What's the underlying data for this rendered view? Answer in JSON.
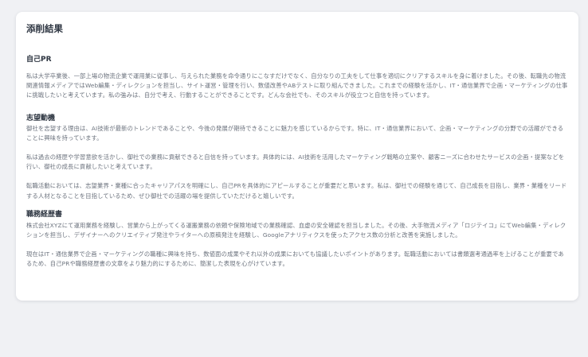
{
  "card": {
    "title": "添削結果"
  },
  "sections": {
    "pr": {
      "heading": "自己PR",
      "paragraphs": [
        "私は大学卒業後、一部上場の物流企業で運用業に従事し、与えられた業務を命令通りにこなすだけでなく、自分なりの工夫をして仕事を適切にクリアするスキルを身に着けました。その後、転職先の物流関連情報メディアではWeb編集・ディレクションを担当し、サイト運営・管理を行い、数値改善やABテストに取り組んできました。これまでの経験を活かし、IT・通信業界で企画・マーケティングの仕事に挑戦したいと考えています。私の強みは、自分で考え、行動することができることです。どんな会社でも、そのスキルが役立つと自信を持っています。"
      ]
    },
    "motive": {
      "heading": "志望動機",
      "paragraphs": [
        "御社を志望する理由は、AI技術が最新のトレンドであることや、今後の発展が期待できることに魅力を感じているからです。特に、IT・通信業界において、企画・マーケティングの分野での活躍ができることに興味を持っています。",
        "私は過去の経歴や学習意欲を活かし、御社での業務に貢献できると自信を持っています。具体的には、AI技術を活用したマーケティング戦略の立案や、顧客ニーズに合わせたサービスの企画・提案などを行い、御社の成長に貢献したいと考えています。",
        "転職活動においては、志望業界・業種に合ったキャリアパスを明確にし、自己PRを具体的にアピールすることが重要だと思います。私は、御社での経験を通じて、自己成長を目指し、業界・業種をリードする人材となることを目指しているため、ぜひ御社での活躍の場を提供していただけると嬉しいです。"
      ]
    },
    "career": {
      "heading": "職務経歴書",
      "paragraphs": [
        "株式会社XYZにて運用業務を経験し、営業から上がってくる運搬業務の依頼や保険地域での業務確認、血虚の安全確認を担当しました。その後、大手物流メディア「ロジテイコ」にてWeb編集・ディレクションを担当し、デザイナーへのクリエイティブ発注やライターへの原稿発注を経験し、Googleアナリティクスを使ったアクセス数の分析と改善を実施しました。",
        "現在はIT・通信業界で企画・マーケティングの職種に興味を持ち、数値面の成果やそれ以外の成果においても協議したいポイントがあります。転職活動においては書類選考通過率を上げることが重要であるため、自己PRや職務経歴書の文章をより魅力的にするために、簡潔した表現を心がけています。"
      ]
    }
  }
}
